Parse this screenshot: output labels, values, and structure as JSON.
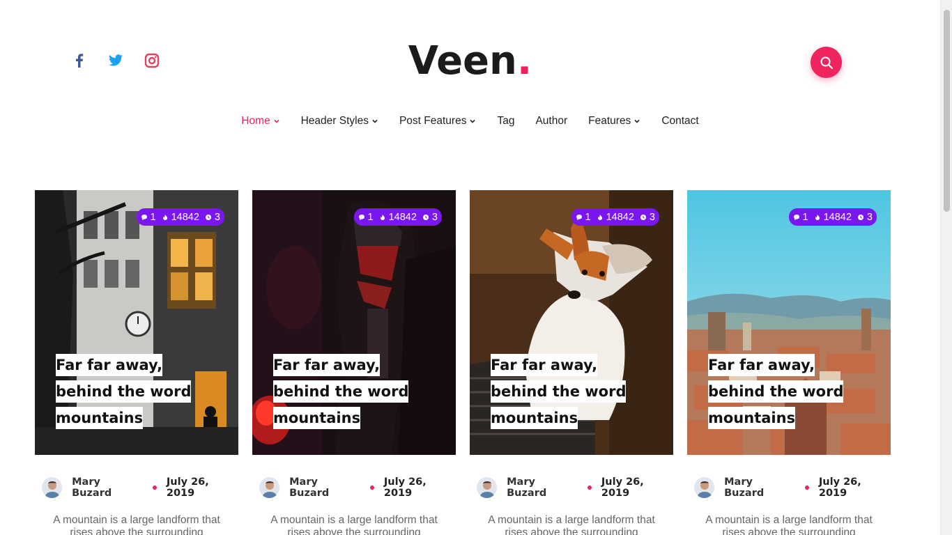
{
  "brand": {
    "name": "Veen",
    "dot": ".",
    "accent": "#f0255e"
  },
  "social": [
    {
      "name": "facebook",
      "color": "#3b5998"
    },
    {
      "name": "twitter",
      "color": "#1da1f2"
    },
    {
      "name": "instagram",
      "color": "#e4405f"
    }
  ],
  "search": {
    "icon": "search-icon"
  },
  "nav": {
    "home": "Home",
    "header_styles": "Header Styles",
    "post_features": "Post Features",
    "tag": "Tag",
    "author": "Author",
    "features": "Features",
    "contact": "Contact"
  },
  "posts": [
    {
      "comments": "1",
      "views": "14842",
      "time": "3",
      "title": "Far far away, behind the word mountains",
      "author": "Mary Buzard",
      "date": "July 26, 2019",
      "excerpt": "A mountain is a large landform that rises above the surrounding"
    },
    {
      "comments": "1",
      "views": "14842",
      "time": "3",
      "title": "Far far away, behind the word mountains",
      "author": "Mary Buzard",
      "date": "July 26, 2019",
      "excerpt": "A mountain is a large landform that rises above the surrounding"
    },
    {
      "comments": "1",
      "views": "14842",
      "time": "3",
      "title": "Far far away, behind the word mountains",
      "author": "Mary Buzard",
      "date": "July 26, 2019",
      "excerpt": "A mountain is a large landform that rises above the surrounding"
    },
    {
      "comments": "1",
      "views": "14842",
      "time": "3",
      "title": "Far far away, behind the word mountains",
      "author": "Mary Buzard",
      "date": "July 26, 2019",
      "excerpt": "A mountain is a large landform that rises above the surrounding"
    }
  ],
  "badge_color": "#7a17f0"
}
